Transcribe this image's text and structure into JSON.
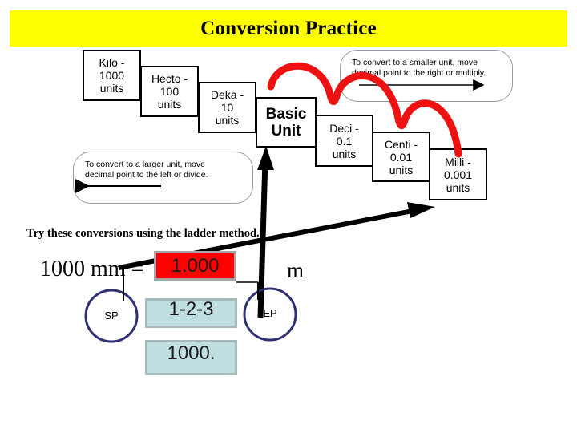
{
  "header": {
    "title": "Conversion Practice",
    "banner_color": "#ffff00"
  },
  "ladder": {
    "steps": [
      {
        "id": "kilo",
        "label": "Kilo -\n1000\nunits"
      },
      {
        "id": "hecto",
        "label": "Hecto -\n100\nunits"
      },
      {
        "id": "deka",
        "label": "Deka -\n10\nunits"
      },
      {
        "id": "basic",
        "label": "Basic\nUnit"
      },
      {
        "id": "deci",
        "label": "Deci -\n0.1\nunits"
      },
      {
        "id": "centi",
        "label": "Centi -\n0.01\nunits"
      },
      {
        "id": "milli",
        "label": "Milli -\n0.001\nunits"
      }
    ],
    "callouts": {
      "larger": "To convert to a larger unit, move\ndecimal  point to the left or divide.",
      "smaller": "To convert to a smaller unit, move\ndecimal  point to the right or multiply."
    },
    "hop_color": "#ee1111"
  },
  "practice": {
    "instruction": "Try these conversions using the ladder method.",
    "equation_left": "1000 mm =",
    "answer": "1.000",
    "answer_box_color": "#ff0000",
    "equation_unit": "m",
    "start_point_label": "SP",
    "end_point_label": "EP",
    "hop_count": "1-2-3",
    "decimal_work": "1000.",
    "work_box_color": "#bfdee0"
  }
}
